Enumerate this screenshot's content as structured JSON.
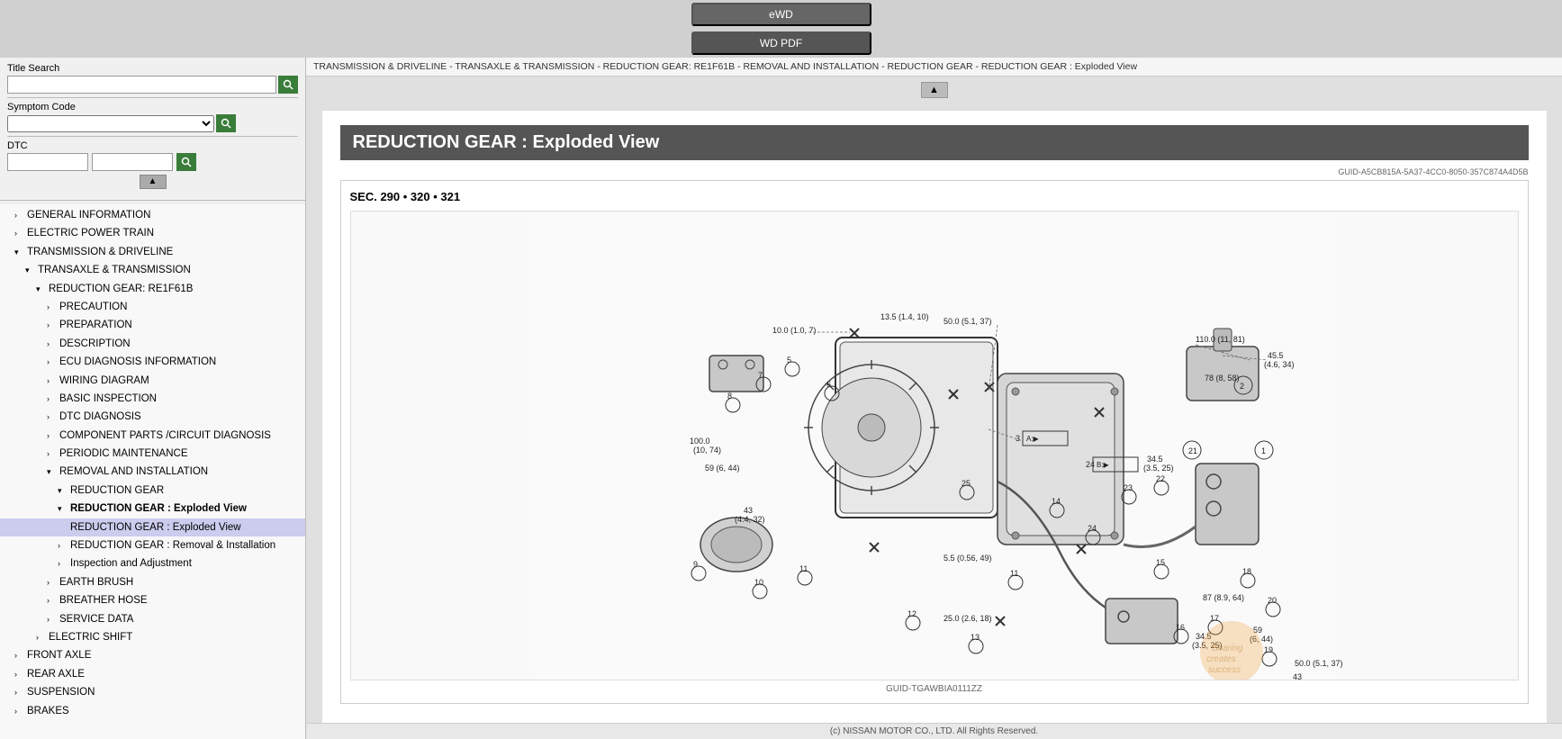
{
  "app": {
    "ewd_label": "eWD",
    "wd_pdf_label": "WD PDF"
  },
  "sidebar": {
    "title_search_label": "Title Search",
    "title_search_placeholder": "",
    "symptom_code_label": "Symptom Code",
    "dtc_label": "DTC",
    "search_icon": "🔍",
    "tree_items": [
      {
        "id": "gi",
        "label": "GENERAL INFORMATION",
        "indent": "indent1",
        "arrow": "›",
        "expanded": false
      },
      {
        "id": "ept",
        "label": "ELECTRIC POWER TRAIN",
        "indent": "indent1",
        "arrow": "›",
        "expanded": false
      },
      {
        "id": "td",
        "label": "TRANSMISSION & DRIVELINE",
        "indent": "indent1",
        "arrow": "▾",
        "expanded": true
      },
      {
        "id": "tt",
        "label": "TRANSAXLE & TRANSMISSION",
        "indent": "indent2",
        "arrow": "▾",
        "expanded": true
      },
      {
        "id": "rg",
        "label": "REDUCTION GEAR: RE1F61B",
        "indent": "indent3",
        "arrow": "▾",
        "expanded": true
      },
      {
        "id": "pre",
        "label": "PRECAUTION",
        "indent": "indent4",
        "arrow": "›",
        "expanded": false
      },
      {
        "id": "prep",
        "label": "PREPARATION",
        "indent": "indent4",
        "arrow": "›",
        "expanded": false
      },
      {
        "id": "desc",
        "label": "DESCRIPTION",
        "indent": "indent4",
        "arrow": "›",
        "expanded": false
      },
      {
        "id": "ecu",
        "label": "ECU DIAGNOSIS INFORMATION",
        "indent": "indent4",
        "arrow": "›",
        "expanded": false
      },
      {
        "id": "wd",
        "label": "WIRING DIAGRAM",
        "indent": "indent4",
        "arrow": "›",
        "expanded": false
      },
      {
        "id": "bi",
        "label": "BASIC INSPECTION",
        "indent": "indent4",
        "arrow": "›",
        "expanded": false
      },
      {
        "id": "dtc",
        "label": "DTC DIAGNOSIS",
        "indent": "indent4",
        "arrow": "›",
        "expanded": false
      },
      {
        "id": "cp",
        "label": "COMPONENT PARTS /CIRCUIT DIAGNOSIS",
        "indent": "indent4",
        "arrow": "›",
        "expanded": false
      },
      {
        "id": "pm",
        "label": "PERIODIC MAINTENANCE",
        "indent": "indent4",
        "arrow": "›",
        "expanded": false
      },
      {
        "id": "rai",
        "label": "REMOVAL AND INSTALLATION",
        "indent": "indent4",
        "arrow": "▾",
        "expanded": true
      },
      {
        "id": "rgear",
        "label": "REDUCTION GEAR",
        "indent": "indent5",
        "arrow": "▾",
        "expanded": true
      },
      {
        "id": "rgev",
        "label": "REDUCTION GEAR : Exploded View",
        "indent": "indent5",
        "arrow": "▾",
        "expanded": true,
        "bold": true
      },
      {
        "id": "rgev2",
        "label": "REDUCTION GEAR : Exploded View",
        "indent": "indent5",
        "arrow": "",
        "expanded": false,
        "selected": true
      },
      {
        "id": "rgri",
        "label": "REDUCTION GEAR : Removal & Installation",
        "indent": "indent5",
        "arrow": "›",
        "expanded": false
      },
      {
        "id": "ia",
        "label": "Inspection and Adjustment",
        "indent": "indent5",
        "arrow": "›",
        "expanded": false
      },
      {
        "id": "eb",
        "label": "EARTH BRUSH",
        "indent": "indent4",
        "arrow": "›",
        "expanded": false
      },
      {
        "id": "bh",
        "label": "BREATHER HOSE",
        "indent": "indent4",
        "arrow": "›",
        "expanded": false
      },
      {
        "id": "sd",
        "label": "SERVICE DATA",
        "indent": "indent4",
        "arrow": "›",
        "expanded": false
      },
      {
        "id": "es",
        "label": "ELECTRIC SHIFT",
        "indent": "indent3",
        "arrow": "›",
        "expanded": false
      },
      {
        "id": "fa",
        "label": "FRONT AXLE",
        "indent": "indent1",
        "arrow": "›",
        "expanded": false
      },
      {
        "id": "ra",
        "label": "REAR AXLE",
        "indent": "indent1",
        "arrow": "›",
        "expanded": false
      },
      {
        "id": "susp",
        "label": "SUSPENSION",
        "indent": "indent1",
        "arrow": "›",
        "expanded": false
      },
      {
        "id": "brakes",
        "label": "BRAKES",
        "indent": "indent1",
        "arrow": "›",
        "expanded": false
      }
    ]
  },
  "breadcrumb": "TRANSMISSION & DRIVELINE - TRANSAXLE & TRANSMISSION - REDUCTION GEAR: RE1F61B - REMOVAL AND INSTALLATION - REDUCTION GEAR - REDUCTION GEAR : Exploded View",
  "content": {
    "page_title": "REDUCTION GEAR : Exploded View",
    "guid_top": "GUID-A5CB815A-5A37-4CC0-8050-357C874A4D5B",
    "section_header": "SEC. 290 • 320 • 321",
    "guid_bottom": "GUID-TGAWBIA0111ZZ",
    "footer": "(c) NISSAN MOTOR CO., LTD. All Rights Reserved."
  },
  "watermark": {
    "text": "Sharing creates success",
    "color": "#f0a040"
  }
}
